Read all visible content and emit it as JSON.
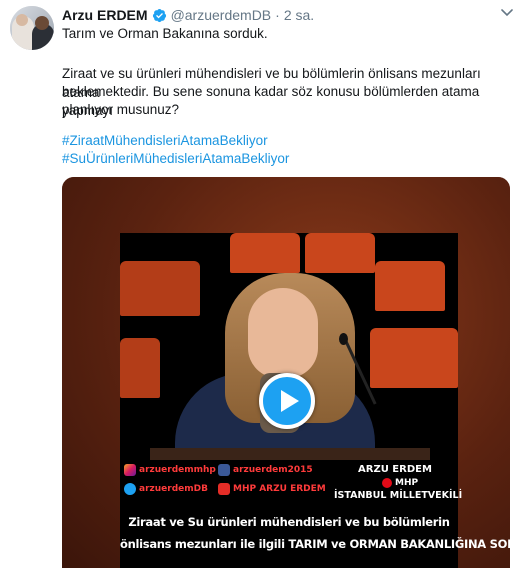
{
  "tweet": {
    "author_name": "Arzu ERDEM",
    "handle": "@arzuerdemDB",
    "separator": "·",
    "time": "2 sa.",
    "lines": [
      "Tarım ve Orman Bakanına sorduk.",
      "Ziraat ve su ürünleri mühendisleri ve bu bölümlerin önlisans mezunları atama",
      "beklemektedir. Bu sene sonuna kadar söz konusu bölümlerden atama yapmayı",
      "planlıyor musunuz?"
    ],
    "hashtags": [
      "#ZiraatMühendisleriAtamaBekliyor",
      "#SuÜrünleriMühedisleriAtamaBekliyor"
    ]
  },
  "video": {
    "social": [
      {
        "icon": "instagram-icon",
        "label": "arzuerdemmhp"
      },
      {
        "icon": "facebook-icon",
        "label": "arzuerdem2015"
      },
      {
        "icon": "twitter-icon",
        "label": "arzuerdemDB"
      },
      {
        "icon": "youtube-icon",
        "label": "MHP ARZU ERDEM"
      }
    ],
    "overlay_name": "ARZU ERDEM",
    "overlay_party": "MHP",
    "overlay_role": "İSTANBUL MİLLETVEKİLİ",
    "subtitle_line1": "Ziraat ve Su ürünleri mühendisleri ve bu bölümlerin",
    "subtitle_line2": "önlisans mezunları ile ilgili TARIM ve ORMAN BAKANLIĞINA SORUMUZ.."
  },
  "colors": {
    "link": "#1b95e0",
    "verified": "#1da1f2",
    "muted": "#657786",
    "overlay_red": "#ff3b3b"
  }
}
